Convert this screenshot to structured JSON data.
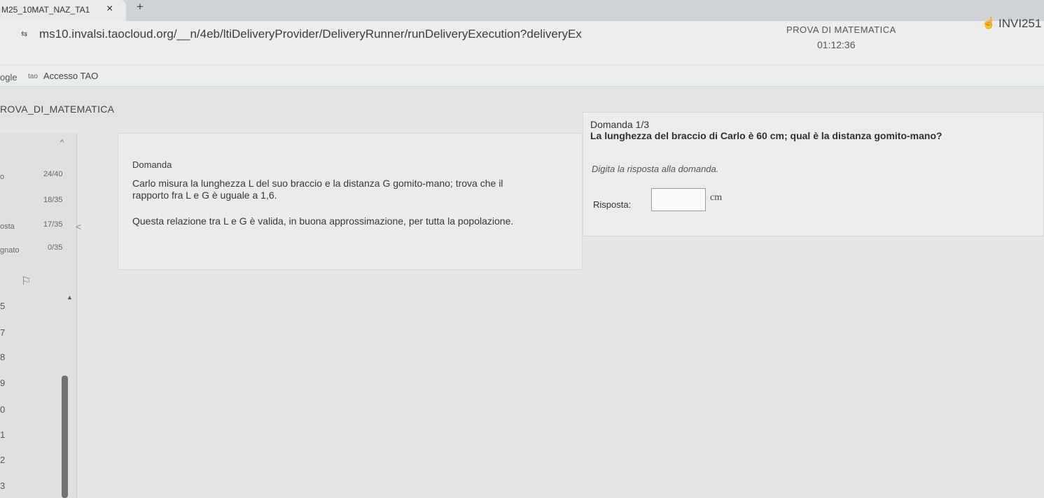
{
  "browser": {
    "tab_title": "M25_10MAT_NAZ_TA1",
    "tab_close": "×",
    "new_tab": "+",
    "url": "ms10.invalsi.taocloud.org/__n/4eb/ltiDeliveryProvider/DeliveryRunner/runDeliveryExecution?deliveryEx",
    "site_icon": "⇆",
    "bookmarks": [
      {
        "label": "ogle"
      },
      {
        "icon": "tao",
        "label": "Accesso TAO"
      }
    ]
  },
  "test": {
    "label": "PROVA DI MATEMATICA",
    "timer": "01:12:36",
    "user_icon": "user-icon",
    "user_id": "INVI251",
    "title": "ROVA_DI_MATEMATICA"
  },
  "sidebar": {
    "top_icon": "",
    "chevron": "^",
    "rows": [
      {
        "label": "o",
        "value": "24/40"
      },
      {
        "label": "",
        "value": "18/35"
      },
      {
        "label": "osta",
        "value": "17/35"
      },
      {
        "label": "gnato",
        "value": "0/35"
      }
    ],
    "collapse": "<",
    "flag": "⚐",
    "up": "▲",
    "numbers": [
      "5",
      "7",
      "8",
      "9",
      "0",
      "1",
      "2",
      "3"
    ]
  },
  "stimulus": {
    "heading": "Domanda",
    "line1": "Carlo misura la lunghezza L del suo braccio e la distanza G gomito-mano; trova che il",
    "line2": "rapporto fra L e G è uguale a 1,6.",
    "line3": "Questa relazione tra L e G è valida, in buona approssimazione, per tutta la popolazione."
  },
  "question": {
    "counter": "Domanda 1/3",
    "text": "La lunghezza del braccio di Carlo è 60 cm; qual è la distanza gomito-mano?",
    "instruction": "Digita la risposta alla domanda.",
    "answer_label": "Risposta:",
    "answer_value": "",
    "unit": "cm"
  }
}
